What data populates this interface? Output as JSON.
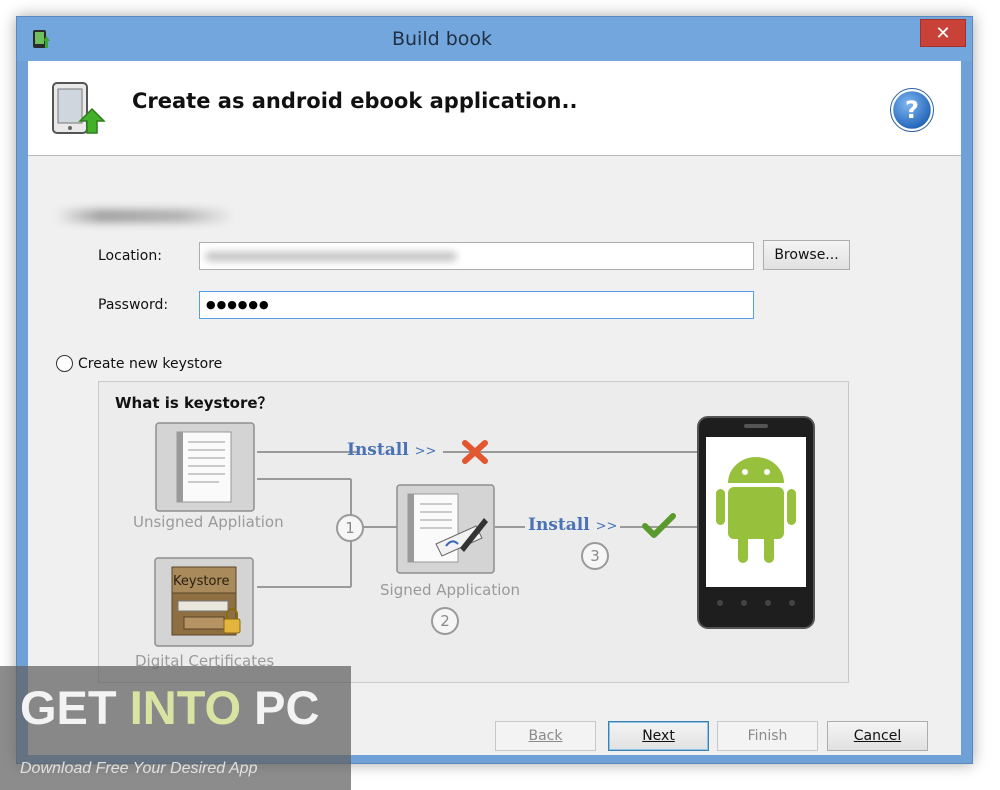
{
  "window": {
    "title": "Build book",
    "close_label": "✕"
  },
  "header": {
    "title": "Create as android ebook application..",
    "help_label": "?"
  },
  "form": {
    "location_label": "Location:",
    "location_value": "",
    "browse_label": "Browse...",
    "password_label": "Password:",
    "password_value": "●●●●●●",
    "create_keystore_label": "Create new keystore"
  },
  "diagram": {
    "title": "What is keystore？",
    "unsigned_label": "Unsigned Appliation",
    "certificates_label": "Digital Certificates",
    "keystore_box_label": "Keystore",
    "signed_label": "Signed Application",
    "install_label": "Install",
    "install_arrows": ">>",
    "steps": [
      "1",
      "2",
      "3"
    ]
  },
  "footer": {
    "back_label": "Back",
    "next_label": "Next",
    "finish_label": "Finish",
    "cancel_label": "Cancel"
  },
  "watermark": {
    "line1_part1": "GET ",
    "line1_part2": "INTO",
    "line1_part3": " PC",
    "line2": "Download Free Your Desired App"
  },
  "colors": {
    "titlebar": "#73a6dd",
    "close": "#c8423a",
    "install_text": "#4a73b6",
    "android_green": "#97c03d",
    "reject": "#e2572f",
    "accept": "#5a9a2c"
  }
}
